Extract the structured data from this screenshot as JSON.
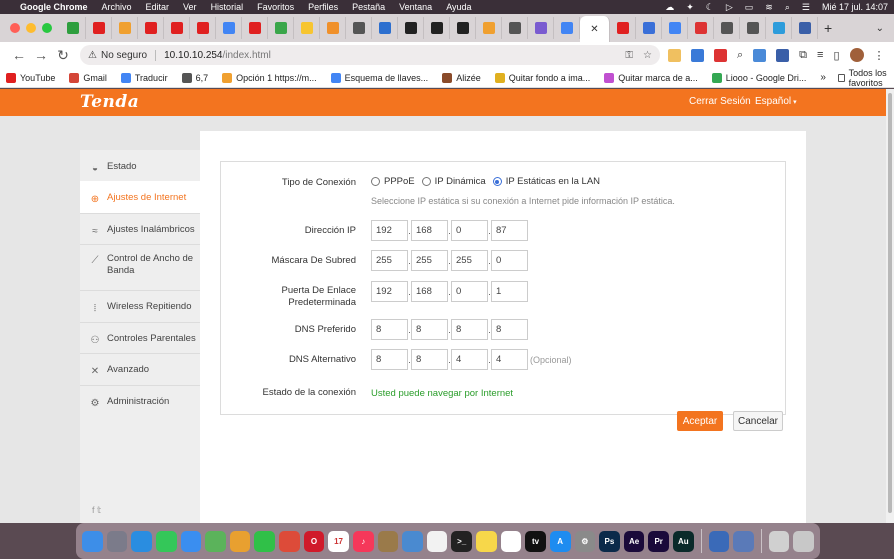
{
  "menubar": {
    "app_name": "Google Chrome",
    "items": [
      "Archivo",
      "Editar",
      "Ver",
      "Historial",
      "Favoritos",
      "Perfiles",
      "Pestaña",
      "Ventana",
      "Ayuda"
    ],
    "clock": "Mié 17 jul.  14:07"
  },
  "tabs": {
    "favicon_colors": [
      "#2e9e3e",
      "#e02020",
      "#f0a030",
      "#e02020",
      "#e02020",
      "#e02020",
      "#4285f4",
      "#e02020",
      "#3aa64a",
      "#f7c530",
      "#f0902a",
      "#555555",
      "#2d6fcf",
      "#222222",
      "#222222",
      "#222222",
      "#f0a030",
      "#555555",
      "#7a5bd0",
      "#4285f4"
    ],
    "active_favicon": "#4285f4",
    "after_colors": [
      "#e02020",
      "#3a6fd8",
      "#4285f4",
      "#d33",
      "#555555",
      "#555555",
      "#2d9cdb",
      "#3a5fa8"
    ]
  },
  "toolbar": {
    "security_label": "No seguro",
    "url_host": "10.10.10.254",
    "url_path": "/index.html"
  },
  "bookmarks": [
    {
      "label": "YouTube",
      "color": "#e02020"
    },
    {
      "label": "Gmail",
      "color": "#d44638"
    },
    {
      "label": "Traducir",
      "color": "#4285f4"
    },
    {
      "label": "6,7",
      "color": "#555555"
    },
    {
      "label": "Opción 1 https://m...",
      "color": "#f0a030"
    },
    {
      "label": "Esquema de llaves...",
      "color": "#4285f4"
    },
    {
      "label": "Alizée",
      "color": "#8a4b2a"
    },
    {
      "label": "Quitar fondo a ima...",
      "color": "#e0b020"
    },
    {
      "label": "Quitar marca de a...",
      "color": "#c050d0"
    },
    {
      "label": "Liooo - Google Dri...",
      "color": "#34a853"
    }
  ],
  "bookmarks_all": "Todos los favoritos",
  "router": {
    "brand": "Tenda",
    "logout": "Cerrar Sesión",
    "language": "Español",
    "nav": [
      {
        "label": "Estado",
        "icon": "gauge-icon",
        "glyph": "◒"
      },
      {
        "label": "Ajustes de Internet",
        "icon": "globe-icon",
        "glyph": "⊕"
      },
      {
        "label": "Ajustes Inalámbricos",
        "icon": "wifi-icon",
        "glyph": "≈"
      },
      {
        "label": "Control de Ancho de Banda",
        "icon": "chart-line-icon",
        "glyph": "⟋"
      },
      {
        "label": "Wireless Repitiendo",
        "icon": "repeater-icon",
        "glyph": "⦙"
      },
      {
        "label": "Controles Parentales",
        "icon": "people-icon",
        "glyph": "⚇"
      },
      {
        "label": "Avanzado",
        "icon": "tools-icon",
        "glyph": "✕"
      },
      {
        "label": "Administración",
        "icon": "gears-icon",
        "glyph": "⚙"
      }
    ],
    "active_index": 1,
    "form": {
      "connection_type_label": "Tipo de Conexión",
      "options": [
        "PPPoE",
        "IP Dinámica",
        "IP Estáticas en la LAN"
      ],
      "selected_option": 2,
      "hint": "Seleccione IP estática si su conexión a Internet pide información IP estática.",
      "ip_label": "Dirección IP",
      "ip": [
        "192",
        "168",
        "0",
        "87"
      ],
      "mask_label": "Máscara De Subred",
      "mask": [
        "255",
        "255",
        "255",
        "0"
      ],
      "gateway_label_1": "Puerta De Enlace",
      "gateway_label_2": "Predeterminada",
      "gateway": [
        "192",
        "168",
        "0",
        "1"
      ],
      "dns1_label": "DNS Preferido",
      "dns1": [
        "8",
        "8",
        "8",
        "8"
      ],
      "dns2_label": "DNS Alternativo",
      "dns2": [
        "8",
        "8",
        "4",
        "4"
      ],
      "optional": "(Opcional)",
      "status_label": "Estado de la conexión",
      "status_value": "Usted puede navegar por Internet"
    },
    "buttons": {
      "accept": "Aceptar",
      "cancel": "Cancelar"
    },
    "social": "f  𝕥"
  },
  "dock_apps": [
    {
      "name": "finder",
      "color": "#3d8ee8",
      "text": ""
    },
    {
      "name": "launchpad",
      "color": "#7b7b8a",
      "text": ""
    },
    {
      "name": "safari",
      "color": "#2a8de0",
      "text": ""
    },
    {
      "name": "messages",
      "color": "#34c759",
      "text": ""
    },
    {
      "name": "mail",
      "color": "#3a8ef0",
      "text": ""
    },
    {
      "name": "maps",
      "color": "#5bb35b",
      "text": ""
    },
    {
      "name": "photos",
      "color": "#e8a030",
      "text": ""
    },
    {
      "name": "facetime",
      "color": "#30c048",
      "text": ""
    },
    {
      "name": "chrome",
      "color": "#dd4b39",
      "text": ""
    },
    {
      "name": "opera",
      "color": "#d01a2a",
      "text": "O"
    },
    {
      "name": "calendar",
      "color": "#ffffff",
      "text": "17"
    },
    {
      "name": "music",
      "color": "#f5385a",
      "text": "♪"
    },
    {
      "name": "notes-brown",
      "color": "#9a7a4a",
      "text": ""
    },
    {
      "name": "keynote",
      "color": "#4a8ad0",
      "text": ""
    },
    {
      "name": "reminders",
      "color": "#f2f2f2",
      "text": ""
    },
    {
      "name": "terminal",
      "color": "#222222",
      "text": ">_"
    },
    {
      "name": "notes",
      "color": "#f7d74a",
      "text": ""
    },
    {
      "name": "freeform",
      "color": "#ffffff",
      "text": ""
    },
    {
      "name": "tv",
      "color": "#111111",
      "text": "tv"
    },
    {
      "name": "app-store",
      "color": "#1e8cf0",
      "text": "A"
    },
    {
      "name": "settings",
      "color": "#8a8a8a",
      "text": "⚙"
    },
    {
      "name": "photoshop",
      "color": "#0b2a4a",
      "text": "Ps"
    },
    {
      "name": "after-effects",
      "color": "#1a0a3a",
      "text": "Ae"
    },
    {
      "name": "premiere",
      "color": "#1a0a3a",
      "text": "Pr"
    },
    {
      "name": "audition",
      "color": "#0a2a2a",
      "text": "Au"
    },
    {
      "name": "vpn",
      "color": "#3a6ab8",
      "text": ""
    },
    {
      "name": "screen",
      "color": "#5a7ab8",
      "text": ""
    },
    {
      "name": "downloads",
      "color": "#d0d0d0",
      "text": ""
    },
    {
      "name": "trash",
      "color": "#c8c8c8",
      "text": ""
    }
  ]
}
